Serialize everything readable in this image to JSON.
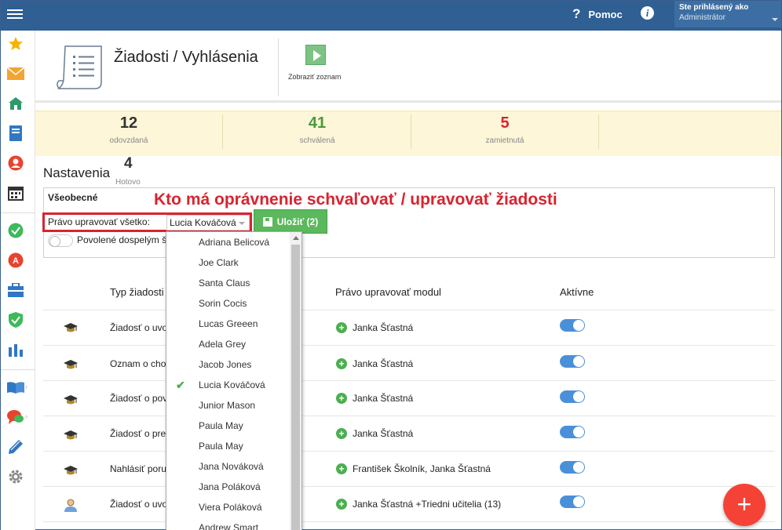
{
  "topbar": {
    "help_label": "Pomoc",
    "user_line1": "Ste prihlásený ako",
    "user_line2": "Administrátor"
  },
  "header": {
    "title": "Žiadosti / Vyhlásenia",
    "list_button_label": "Zobraziť zoznam"
  },
  "stats": [
    {
      "value": "12",
      "label": "odovzdaná",
      "color": "#333333"
    },
    {
      "value": "41",
      "label": "schválená",
      "color": "#4a9a3b"
    },
    {
      "value": "5",
      "label": "zamietnutá",
      "color": "#d9232f"
    }
  ],
  "hotovo": {
    "value": "4",
    "label": "Hotovo"
  },
  "settings": {
    "title": "Nastavenia",
    "panel_title": "Všeobecné",
    "annotation": "Kto má oprávnenie schvaľovať / upravovať žiadosti",
    "pravo_label": "Právo upravovať všetko:",
    "pravo_value": "Lucia Kováčová",
    "save_label": "Uložiť (2)",
    "povolene_label": "Povolené dospelým š"
  },
  "table": {
    "headers": [
      "Typ žiadosti",
      "Právo upravovať modul",
      "Aktívne"
    ],
    "rows": [
      {
        "icon": "graduation-cap-icon",
        "typ": "Žiadosť o uvo",
        "modul": "Janka Šťastná"
      },
      {
        "icon": "graduation-cap-icon",
        "typ": "Oznam o cho",
        "modul": "Janka Šťastná"
      },
      {
        "icon": "graduation-cap-icon",
        "typ": "Žiadosť o pov",
        "modul": "Janka Šťastná"
      },
      {
        "icon": "graduation-cap-icon",
        "typ": "Žiadosť o pre",
        "modul": "Janka Šťastná"
      },
      {
        "icon": "graduation-cap-icon",
        "typ": "Nahlásiť poru",
        "modul": "František Školník, Janka Šťastná"
      },
      {
        "icon": "teacher-icon",
        "typ": "Žiadosť o uvo",
        "modul": "Janka Šťastná +Triedni učitelia (13)"
      }
    ]
  },
  "dropdown": {
    "selected_index": 7,
    "options": [
      "Adriana Belicová",
      "Joe Clark",
      "Santa Claus",
      "Sorin Cocis",
      "Lucas Greeen",
      "Adela Grey",
      "Jacob Jones",
      "Lucia Kováčová",
      "Junior Mason",
      "Paula May",
      "Paula May",
      "Jana Nováková",
      "Jana Poláková",
      "Viera Poláková",
      "Andrew Smart"
    ]
  },
  "fab_label": "+",
  "colors": {
    "topbar": "#2f5f93",
    "accent_green": "#5cb85c",
    "annotation_red": "#d9232f",
    "toggle_blue": "#4a90d9",
    "fab_red": "#f44336"
  }
}
